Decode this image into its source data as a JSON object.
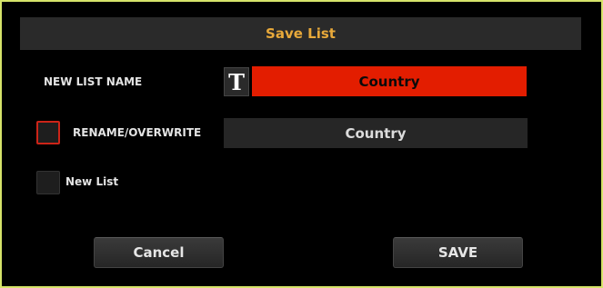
{
  "dialog": {
    "title": "Save List",
    "new_list_name_label": "NEW LIST NAME",
    "name_edit_icon": "T",
    "name_value": "Country",
    "rename_label": "RENAME/OVERWRITE",
    "existing_list_value": "Country",
    "new_list_label": "New List",
    "cancel_label": "Cancel",
    "save_label": "SAVE"
  },
  "colors": {
    "border": "#d6e46a",
    "title_text": "#e8a93a",
    "name_field_bg": "#e31d00",
    "checkbox_selected_border": "#cc2418"
  }
}
